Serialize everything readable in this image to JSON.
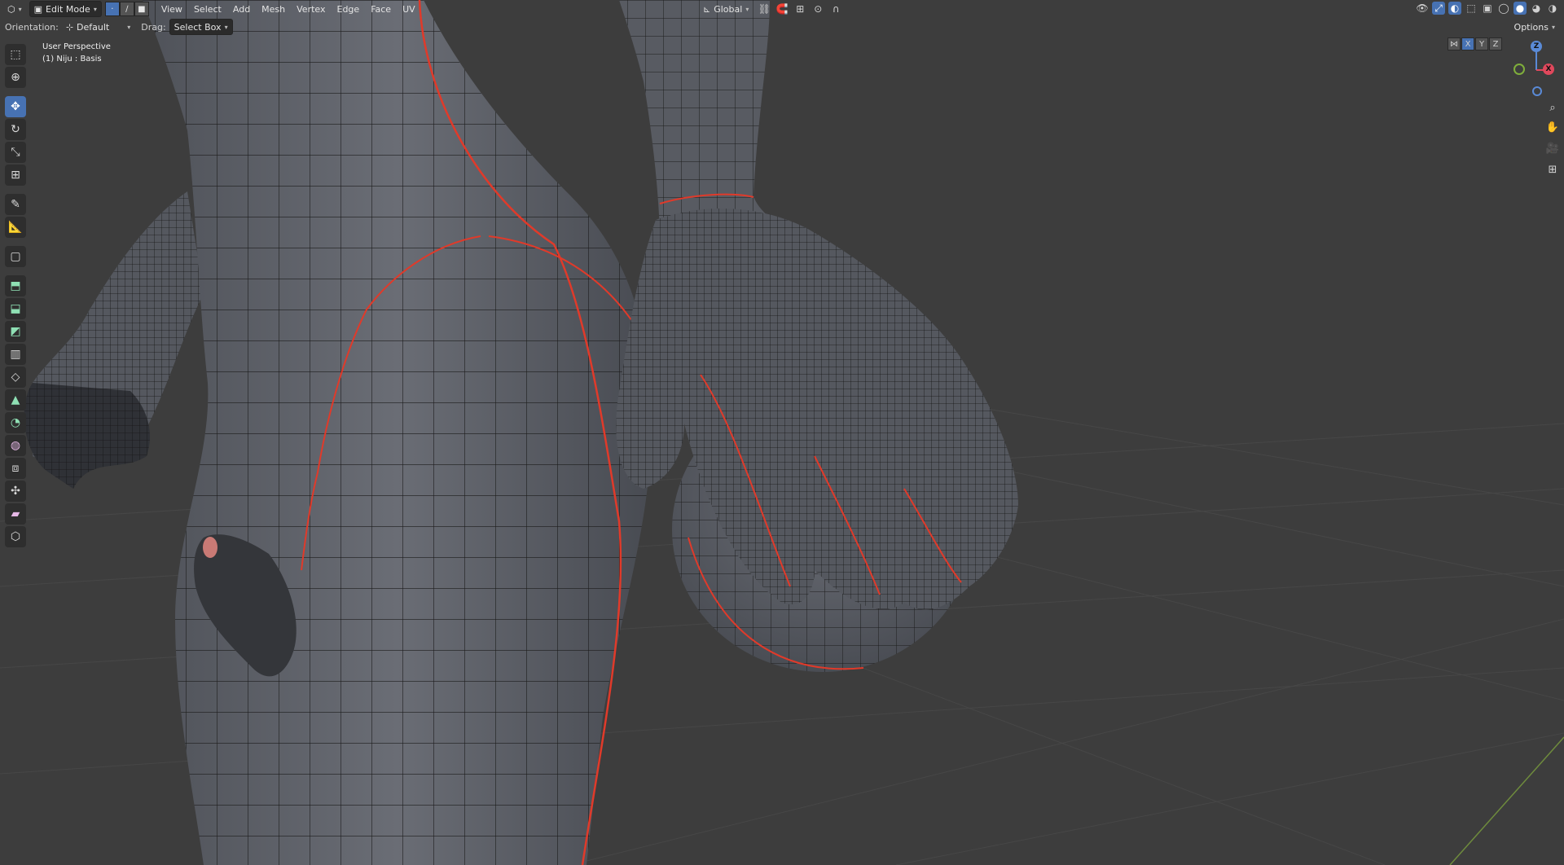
{
  "header": {
    "editor_type_icon": "cube-icon",
    "mode": "Edit Mode",
    "select_modes": [
      "vertex",
      "edge",
      "face"
    ],
    "menus": [
      "View",
      "Select",
      "Add",
      "Mesh",
      "Vertex",
      "Edge",
      "Face",
      "UV"
    ],
    "transform_orientation": "Global"
  },
  "tool_settings": {
    "orientation_label": "Orientation:",
    "orientation_value": "Default",
    "drag_label": "Drag:",
    "drag_value": "Select Box",
    "mirror_axes": [
      "X",
      "Y",
      "Z"
    ],
    "options_label": "Options"
  },
  "viewport": {
    "perspective": "User Perspective",
    "object_info": "(1) Niju : Basis"
  },
  "gizmo": {
    "z": "Z",
    "x": "X"
  },
  "colors": {
    "background": "#3d3d3d",
    "accent": "#4772b3",
    "mesh_body": "#5c5f66",
    "seam": "#e03a2a",
    "wire": "#1a1a1a"
  }
}
